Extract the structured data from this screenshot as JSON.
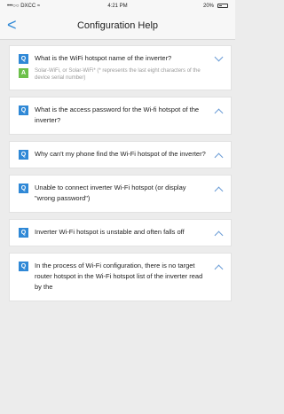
{
  "status_bar": {
    "carrier": "•••○○ DXCC  ≈",
    "time": "4:21 PM",
    "battery": "20%"
  },
  "nav": {
    "back": "<",
    "title": "Configuration  Help"
  },
  "faq": [
    {
      "q": "What is the WiFi hotspot name of the inverter?",
      "a": "Solar-WiFi, or Solar-WiFi* (* represents the last eight characters of the device serial number)",
      "expanded": true
    },
    {
      "q": "What is the access password for the Wi-fi hotspot of the inverter?",
      "expanded": false
    },
    {
      "q": "Why can't my phone find the Wi-Fi hotspot of the inverter?",
      "expanded": false
    },
    {
      "q": "Unable to connect inverter Wi-Fi hotspot (or display \"wrong password\")",
      "expanded": false
    },
    {
      "q": "Inverter Wi-Fi hotspot is unstable and often falls off",
      "expanded": false
    },
    {
      "q": "In the process of Wi-Fi configuration, there is no target router hotspot in the Wi-Fi hotspot list of the inverter read by the",
      "expanded": false
    }
  ],
  "badge_q": "Q",
  "badge_a": "A"
}
